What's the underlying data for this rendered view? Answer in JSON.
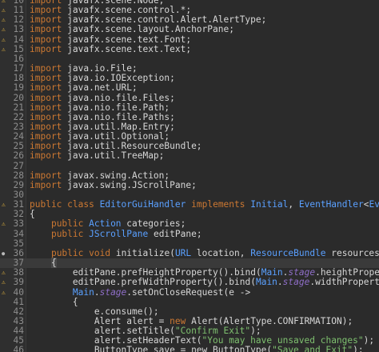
{
  "editor": {
    "lines": [
      {
        "no": "10",
        "marker": "warn",
        "parts": [
          [
            "kw",
            "import"
          ],
          [
            "plain",
            " javafx.scene.Node;"
          ]
        ]
      },
      {
        "no": "11",
        "marker": "warn",
        "parts": [
          [
            "kw",
            "import"
          ],
          [
            "plain",
            " javafx.scene.control.*;"
          ]
        ]
      },
      {
        "no": "12",
        "marker": "warn",
        "parts": [
          [
            "kw",
            "import"
          ],
          [
            "plain",
            " javafx.scene.control.Alert.AlertType;"
          ]
        ]
      },
      {
        "no": "13",
        "marker": "warn",
        "parts": [
          [
            "kw",
            "import"
          ],
          [
            "plain",
            " javafx.scene.layout.AnchorPane;"
          ]
        ]
      },
      {
        "no": "14",
        "marker": "warn",
        "parts": [
          [
            "kw",
            "import"
          ],
          [
            "plain",
            " javafx.scene.text.Font;"
          ]
        ]
      },
      {
        "no": "15",
        "marker": "warn",
        "parts": [
          [
            "kw",
            "import"
          ],
          [
            "plain",
            " javafx.scene.text.Text;"
          ]
        ]
      },
      {
        "no": "16",
        "marker": "",
        "parts": []
      },
      {
        "no": "17",
        "marker": "",
        "parts": [
          [
            "kw",
            "import"
          ],
          [
            "plain",
            " java.io.File;"
          ]
        ]
      },
      {
        "no": "18",
        "marker": "",
        "parts": [
          [
            "kw",
            "import"
          ],
          [
            "plain",
            " java.io.IOException;"
          ]
        ]
      },
      {
        "no": "19",
        "marker": "",
        "parts": [
          [
            "kw",
            "import"
          ],
          [
            "plain",
            " java.net.URL;"
          ]
        ]
      },
      {
        "no": "20",
        "marker": "",
        "parts": [
          [
            "kw",
            "import"
          ],
          [
            "plain",
            " java.nio.file.Files;"
          ]
        ]
      },
      {
        "no": "21",
        "marker": "",
        "parts": [
          [
            "kw",
            "import"
          ],
          [
            "plain",
            " java.nio.file.Path;"
          ]
        ]
      },
      {
        "no": "22",
        "marker": "",
        "parts": [
          [
            "kw",
            "import"
          ],
          [
            "plain",
            " java.nio.file.Paths;"
          ]
        ]
      },
      {
        "no": "23",
        "marker": "",
        "parts": [
          [
            "kw",
            "import"
          ],
          [
            "plain",
            " java.util.Map.Entry;"
          ]
        ]
      },
      {
        "no": "24",
        "marker": "",
        "parts": [
          [
            "kw",
            "import"
          ],
          [
            "plain",
            " java.util.Optional;"
          ]
        ]
      },
      {
        "no": "25",
        "marker": "",
        "parts": [
          [
            "kw",
            "import"
          ],
          [
            "plain",
            " java.util.ResourceBundle;"
          ]
        ]
      },
      {
        "no": "26",
        "marker": "",
        "parts": [
          [
            "kw",
            "import"
          ],
          [
            "plain",
            " java.util.TreeMap;"
          ]
        ]
      },
      {
        "no": "27",
        "marker": "",
        "parts": []
      },
      {
        "no": "28",
        "marker": "",
        "parts": [
          [
            "kw",
            "import"
          ],
          [
            "plain",
            " javax.swing.Action;"
          ]
        ]
      },
      {
        "no": "29",
        "marker": "",
        "parts": [
          [
            "kw",
            "import"
          ],
          [
            "plain",
            " javax.swing.JScrollPane;"
          ]
        ]
      },
      {
        "no": "30",
        "marker": "",
        "parts": []
      },
      {
        "no": "31",
        "marker": "warn",
        "parts": [
          [
            "kw",
            "public"
          ],
          [
            "plain",
            " "
          ],
          [
            "kw",
            "class"
          ],
          [
            "plain",
            " "
          ],
          [
            "type",
            "EditorGuiHandler"
          ],
          [
            "plain",
            " "
          ],
          [
            "kw",
            "implements"
          ],
          [
            "plain",
            " "
          ],
          [
            "type",
            "Initial"
          ],
          [
            "plain",
            ", "
          ],
          [
            "type",
            "EventHandler"
          ],
          [
            "plain",
            "<"
          ],
          [
            "type",
            "Event"
          ],
          [
            "plain",
            ">"
          ]
        ]
      },
      {
        "no": "32",
        "marker": "",
        "parts": [
          [
            "plain",
            "{"
          ]
        ]
      },
      {
        "no": "33",
        "marker": "warn",
        "parts": [
          [
            "plain",
            "    "
          ],
          [
            "kw",
            "public"
          ],
          [
            "plain",
            " "
          ],
          [
            "type",
            "Action"
          ],
          [
            "plain",
            " categories;"
          ]
        ]
      },
      {
        "no": "34",
        "marker": "",
        "parts": [
          [
            "plain",
            "    "
          ],
          [
            "kw",
            "public"
          ],
          [
            "plain",
            " "
          ],
          [
            "type",
            "JScrollPane"
          ],
          [
            "plain",
            " editPane;"
          ]
        ]
      },
      {
        "no": "35",
        "marker": "",
        "parts": []
      },
      {
        "no": "36",
        "marker": "override",
        "parts": [
          [
            "plain",
            "    "
          ],
          [
            "kw",
            "public"
          ],
          [
            "plain",
            " "
          ],
          [
            "kw",
            "void"
          ],
          [
            "plain",
            " "
          ],
          [
            "method",
            "initialize"
          ],
          [
            "plain",
            "("
          ],
          [
            "type",
            "URL"
          ],
          [
            "plain",
            " location, "
          ],
          [
            "type",
            "ResourceBundle"
          ],
          [
            "plain",
            " resources)"
          ]
        ]
      },
      {
        "no": "37",
        "marker": "",
        "current": true,
        "parts": [
          [
            "plain",
            "    "
          ],
          [
            "bracket",
            "{"
          ]
        ]
      },
      {
        "no": "38",
        "marker": "warn",
        "parts": [
          [
            "plain",
            "        "
          ],
          [
            "var",
            "editPane"
          ],
          [
            "plain",
            "."
          ],
          [
            "method",
            "prefHeightProperty"
          ],
          [
            "plain",
            "()."
          ],
          [
            "method",
            "bind"
          ],
          [
            "plain",
            "("
          ],
          [
            "type",
            "Main"
          ],
          [
            "plain",
            "."
          ],
          [
            "field",
            "stage"
          ],
          [
            "plain",
            "."
          ],
          [
            "method",
            "heightProperty"
          ],
          [
            "plain",
            "());"
          ]
        ]
      },
      {
        "no": "39",
        "marker": "warn",
        "parts": [
          [
            "plain",
            "        "
          ],
          [
            "var",
            "editPane"
          ],
          [
            "plain",
            "."
          ],
          [
            "method",
            "prefWidthProperty"
          ],
          [
            "plain",
            "()."
          ],
          [
            "method",
            "bind"
          ],
          [
            "plain",
            "("
          ],
          [
            "type",
            "Main"
          ],
          [
            "plain",
            "."
          ],
          [
            "field",
            "stage"
          ],
          [
            "plain",
            "."
          ],
          [
            "method",
            "widthProperty"
          ],
          [
            "plain",
            "());"
          ]
        ]
      },
      {
        "no": "40",
        "marker": "warn",
        "parts": [
          [
            "plain",
            "        "
          ],
          [
            "type",
            "Main"
          ],
          [
            "plain",
            "."
          ],
          [
            "field",
            "stage"
          ],
          [
            "plain",
            "."
          ],
          [
            "method",
            "setOnCloseRequest"
          ],
          [
            "plain",
            "("
          ],
          [
            "var",
            "e"
          ],
          [
            "plain",
            " ->"
          ]
        ]
      },
      {
        "no": "41",
        "marker": "",
        "parts": [
          [
            "plain",
            "        {"
          ]
        ]
      },
      {
        "no": "42",
        "marker": "",
        "parts": [
          [
            "plain",
            "            e.consume();"
          ]
        ]
      },
      {
        "no": "43",
        "marker": "",
        "parts": [
          [
            "plain",
            "            Alert "
          ],
          [
            "var2",
            "alert"
          ],
          [
            "plain",
            " = "
          ],
          [
            "kw",
            "new"
          ],
          [
            "plain",
            " Alert(AlertType.CONFIRMATION);"
          ]
        ]
      },
      {
        "no": "44",
        "marker": "",
        "parts": [
          [
            "plain",
            "            alert.setTitle("
          ],
          [
            "str",
            "\"Confirm Exit\""
          ],
          [
            "plain",
            ");"
          ]
        ]
      },
      {
        "no": "45",
        "marker": "",
        "parts": [
          [
            "plain",
            "            alert.setHeaderText("
          ],
          [
            "str",
            "\"You may have unsaved changes\""
          ],
          [
            "plain",
            ");"
          ]
        ]
      },
      {
        "no": "46",
        "marker": "",
        "parts": [
          [
            "plain",
            "            ButtonType save = new ButtonType("
          ],
          [
            "str",
            "\"Save and Exit\""
          ],
          [
            "plain",
            ");"
          ]
        ]
      }
    ]
  }
}
